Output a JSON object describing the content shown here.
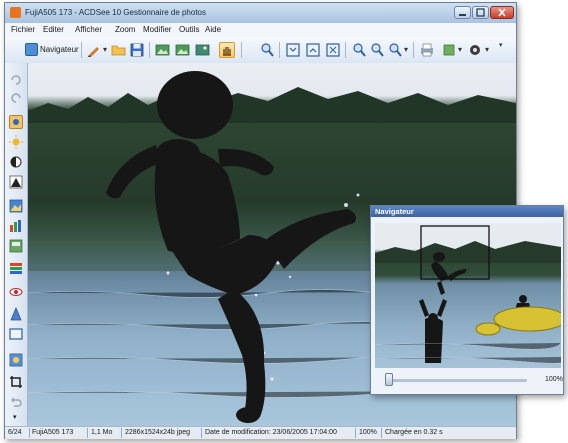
{
  "window": {
    "title": "FujiA505 173 - ACDSee 10 Gestionnaire de photos",
    "controls": [
      "minimize-icon",
      "maximize-icon",
      "close-icon"
    ]
  },
  "menu": [
    "Fichier",
    "Editer",
    "Afficher",
    "Zoom",
    "Modifier",
    "Outils",
    "Aide"
  ],
  "toolbar": {
    "navigator_label": "Navigateur",
    "dropdown_glyph": "▾",
    "icons": [
      "navigator-icon",
      "edit-icon",
      "open-folder-icon",
      "save-icon",
      "image-icon",
      "image-icon",
      "image-icon",
      "hand-icon",
      "zoom-in-icon",
      "fit-icon",
      "fit-width-icon",
      "actual-size-icon",
      "zoom-icon",
      "zoom-icon",
      "zoom-dropdown-icon",
      "print-icon",
      "share-icon",
      "settings-icon"
    ]
  },
  "sidebar": {
    "icons": [
      "rotate-left-icon",
      "rotate-right-icon",
      "exposure-icon",
      "brightness-icon",
      "contrast-icon",
      "levels-icon",
      "color-icon",
      "histogram-icon",
      "adjust-icon",
      "effects-icon",
      "red-eye-icon",
      "sharpen-icon",
      "frame-icon",
      "photo-icon",
      "crop-icon",
      "undo-icon"
    ]
  },
  "status": {
    "index": "6/24",
    "filename": "FujiA505 173",
    "size": "1,1 Mo",
    "dimensions": "2286x1524x24b jpeg",
    "modified": "Date de modification: 23/06/2005 17:04:00",
    "zoom": "100%",
    "load": "Chargée en  0.32 s"
  },
  "navigator": {
    "title": "Navigateur",
    "zoom_label": "100%",
    "zoom_level": 0.0
  },
  "colors": {
    "title_bar": "#b9cfe8",
    "accent": "#3a62a6",
    "close": "#c2402c"
  }
}
